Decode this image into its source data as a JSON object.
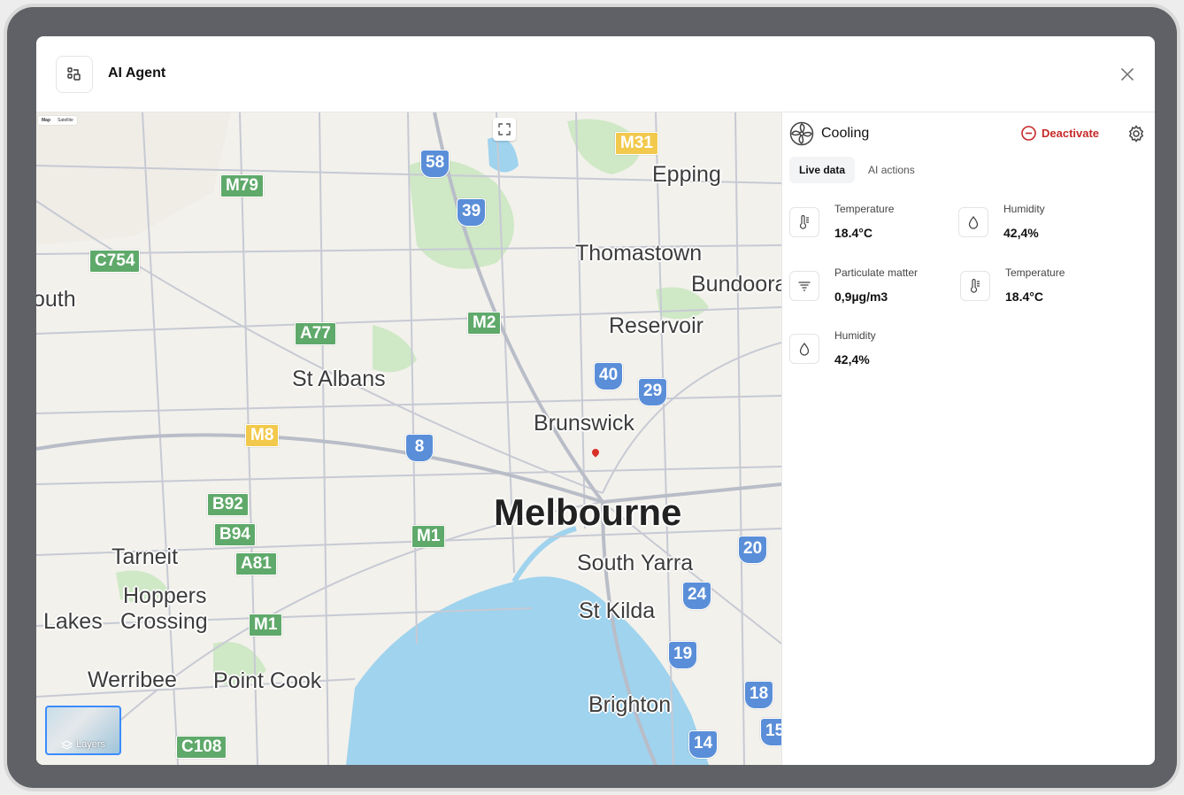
{
  "modal": {
    "title": "AI Agent"
  },
  "map": {
    "toggle": [
      "Map",
      "Satellite"
    ],
    "layers_label": "Layers",
    "places": [
      {
        "name": "Epping",
        "size": 25
      },
      {
        "name": "Thomastown",
        "size": 25
      },
      {
        "name": "Bundoora",
        "size": 25
      },
      {
        "name": "Reservoir",
        "size": 25
      },
      {
        "name": "St Albans",
        "size": 25
      },
      {
        "name": "Brunswick",
        "size": 25
      },
      {
        "name": "Melbourne",
        "size": 42
      },
      {
        "name": "South Yarra",
        "size": 25
      },
      {
        "name": "St Kilda",
        "size": 25
      },
      {
        "name": "Tarneit",
        "size": 25
      },
      {
        "name": "Hoppers",
        "size": 25
      },
      {
        "name": "Crossing",
        "size": 25
      },
      {
        "name": "Lakes",
        "size": 25
      },
      {
        "name": "Werribee",
        "size": 25
      },
      {
        "name": "Point Cook",
        "size": 25
      },
      {
        "name": "Brighton",
        "size": 25
      },
      {
        "name": "outh",
        "size": 25
      }
    ],
    "shields": [
      {
        "label": "M79",
        "color": "green"
      },
      {
        "label": "C754",
        "color": "green"
      },
      {
        "label": "58",
        "color": "blue"
      },
      {
        "label": "39",
        "color": "blue"
      },
      {
        "label": "M31",
        "color": "yellow"
      },
      {
        "label": "A77",
        "color": "green"
      },
      {
        "label": "M2",
        "color": "green"
      },
      {
        "label": "40",
        "color": "blue"
      },
      {
        "label": "29",
        "color": "blue"
      },
      {
        "label": "M8",
        "color": "yellow"
      },
      {
        "label": "8",
        "color": "blue"
      },
      {
        "label": "B92",
        "color": "green"
      },
      {
        "label": "B94",
        "color": "green"
      },
      {
        "label": "A81",
        "color": "green"
      },
      {
        "label": "M1",
        "color": "green"
      },
      {
        "label": "M1",
        "color": "green"
      },
      {
        "label": "20",
        "color": "blue"
      },
      {
        "label": "24",
        "color": "blue"
      },
      {
        "label": "19",
        "color": "blue"
      },
      {
        "label": "18",
        "color": "blue"
      },
      {
        "label": "14",
        "color": "blue"
      },
      {
        "label": "15",
        "color": "blue"
      },
      {
        "label": "C108",
        "color": "green"
      }
    ]
  },
  "panel": {
    "title": "Cooling",
    "deactivate_label": "Deactivate",
    "tabs": [
      "Live data",
      "AI actions"
    ],
    "metrics": [
      {
        "label": "Temperature",
        "value": "18.4°C",
        "icon": "thermometer-icon"
      },
      {
        "label": "Humidity",
        "value": "42,4%",
        "icon": "droplet-icon"
      },
      {
        "label": "Particulate matter",
        "value": "0,9µg/m3",
        "icon": "filter-icon"
      },
      {
        "label": "Temperature",
        "value": "18.4°C",
        "icon": "thermometer-icon"
      },
      {
        "label": "Humidity",
        "value": "42,4%",
        "icon": "droplet-icon"
      }
    ]
  },
  "colors": {
    "accent_danger": "#c62828",
    "water": "#9fd3ee",
    "park": "#c8e6c0",
    "road": "#c7cad4"
  }
}
